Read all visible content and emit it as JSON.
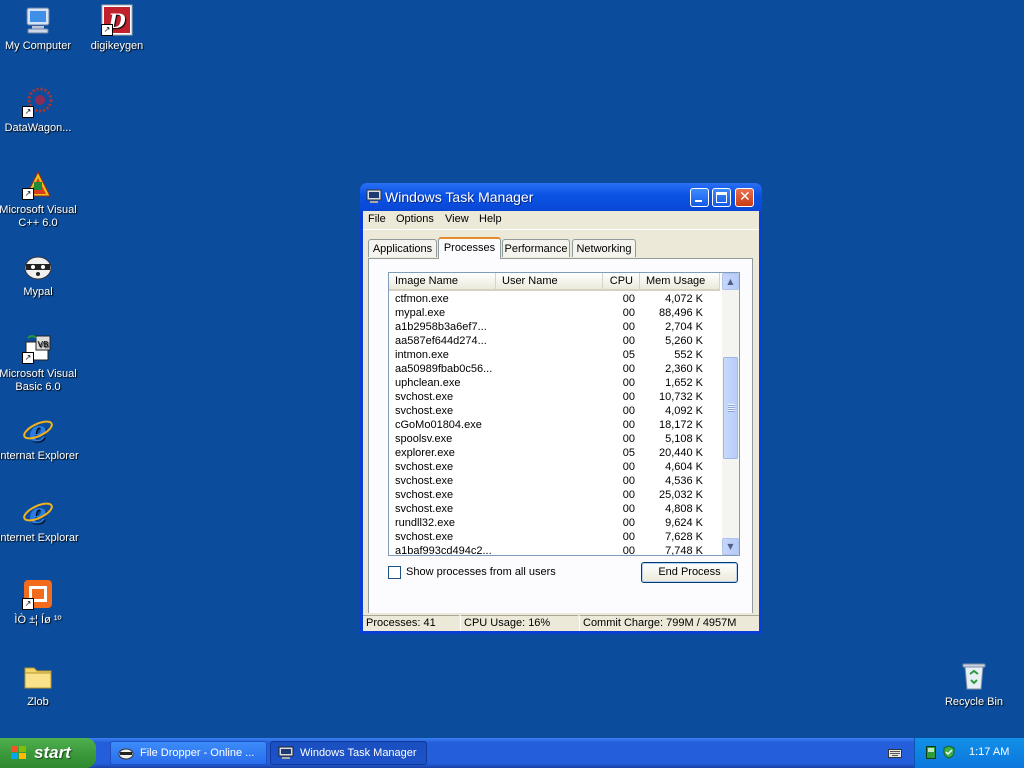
{
  "desktop": {
    "icons": [
      {
        "label": "My Computer"
      },
      {
        "label": "digikeygen"
      },
      {
        "label": "DataWagon..."
      },
      {
        "label": "Microsoft Visual C++ 6.0"
      },
      {
        "label": "Mypal"
      },
      {
        "label": "Microsoft Visual Basic 6.0"
      },
      {
        "label": "Internat Explorer"
      },
      {
        "label": "Internet Explorar"
      },
      {
        "label": "ÌÒ ±¦ Íø ¹º"
      },
      {
        "label": "Zlob"
      },
      {
        "label": "Recycle Bin"
      }
    ]
  },
  "window": {
    "title": "Windows Task Manager",
    "menu": [
      "File",
      "Options",
      "View",
      "Help"
    ],
    "tabs": [
      "Applications",
      "Processes",
      "Performance",
      "Networking"
    ],
    "active_tab": "Processes",
    "columns": [
      "Image Name",
      "User Name",
      "CPU",
      "Mem Usage"
    ],
    "rows": [
      {
        "name": "ctfmon.exe",
        "user": "",
        "cpu": "00",
        "mem": "4,072 K"
      },
      {
        "name": "mypal.exe",
        "user": "",
        "cpu": "00",
        "mem": "88,496 K"
      },
      {
        "name": "a1b2958b3a6ef7...",
        "user": "",
        "cpu": "00",
        "mem": "2,704 K"
      },
      {
        "name": "aa587ef644d274...",
        "user": "",
        "cpu": "00",
        "mem": "5,260 K"
      },
      {
        "name": "intmon.exe",
        "user": "",
        "cpu": "05",
        "mem": "552 K"
      },
      {
        "name": "aa50989fbab0c56...",
        "user": "",
        "cpu": "00",
        "mem": "2,360 K"
      },
      {
        "name": "uphclean.exe",
        "user": "",
        "cpu": "00",
        "mem": "1,652 K"
      },
      {
        "name": "svchost.exe",
        "user": "",
        "cpu": "00",
        "mem": "10,732 K"
      },
      {
        "name": "svchost.exe",
        "user": "",
        "cpu": "00",
        "mem": "4,092 K"
      },
      {
        "name": "cGoMo01804.exe",
        "user": "",
        "cpu": "00",
        "mem": "18,172 K"
      },
      {
        "name": "spoolsv.exe",
        "user": "",
        "cpu": "00",
        "mem": "5,108 K"
      },
      {
        "name": "explorer.exe",
        "user": "",
        "cpu": "05",
        "mem": "20,440 K"
      },
      {
        "name": "svchost.exe",
        "user": "",
        "cpu": "00",
        "mem": "4,604 K"
      },
      {
        "name": "svchost.exe",
        "user": "",
        "cpu": "00",
        "mem": "4,536 K"
      },
      {
        "name": "svchost.exe",
        "user": "",
        "cpu": "00",
        "mem": "25,032 K"
      },
      {
        "name": "svchost.exe",
        "user": "",
        "cpu": "00",
        "mem": "4,808 K"
      },
      {
        "name": "rundll32.exe",
        "user": "",
        "cpu": "00",
        "mem": "9,624 K"
      },
      {
        "name": "svchost.exe",
        "user": "",
        "cpu": "00",
        "mem": "7,628 K"
      },
      {
        "name": "a1baf993cd494c2...",
        "user": "",
        "cpu": "00",
        "mem": "7,748 K"
      }
    ],
    "show_all_label": "Show processes from all users",
    "show_all_checked": false,
    "end_process_label": "End Process",
    "status": {
      "processes": "Processes: 41",
      "cpu": "CPU Usage: 16%",
      "commit": "Commit Charge: 799M / 4957M"
    }
  },
  "taskbar": {
    "start_label": "start",
    "buttons": [
      {
        "label": "File Dropper - Online ...",
        "active": false
      },
      {
        "label": "Windows Task Manager",
        "active": true
      }
    ],
    "clock": "1:17 AM"
  },
  "colors": {
    "desktop_bg": "#0b4d9c",
    "title_blue": "#0b54e5",
    "window_face": "#ece9d8",
    "tab_accent": "#e68b2c"
  }
}
